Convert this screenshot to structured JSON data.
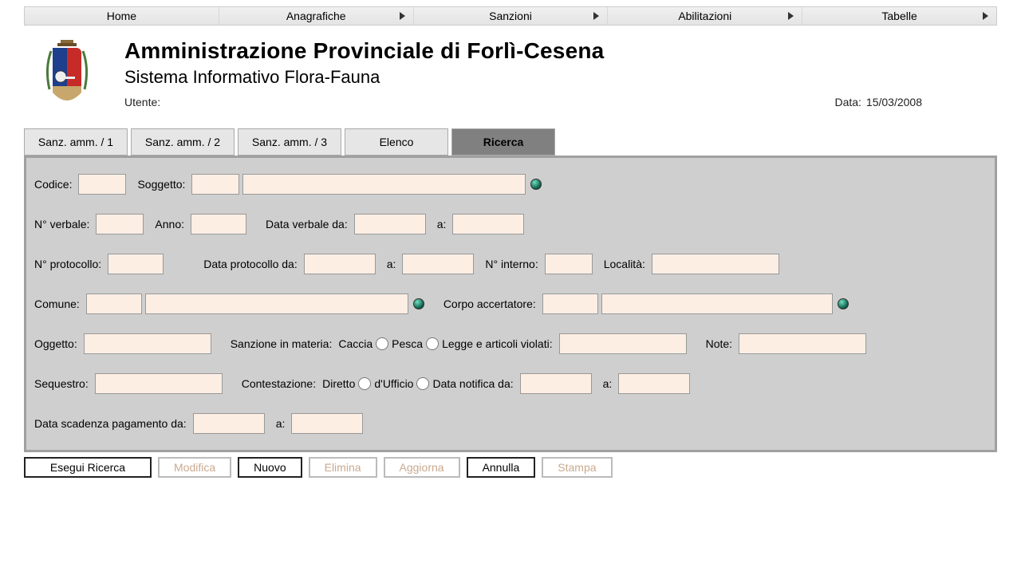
{
  "menu": {
    "home": "Home",
    "anagrafiche": "Anagrafiche",
    "sanzioni": "Sanzioni",
    "abilitazioni": "Abilitazioni",
    "tabelle": "Tabelle"
  },
  "header": {
    "title": "Amministrazione Provinciale di Forlì-Cesena",
    "subtitle": "Sistema Informativo Flora-Fauna",
    "user_label": "Utente:",
    "user_value": "",
    "date_label": "Data:",
    "date_value": "15/03/2008"
  },
  "tabs": {
    "t1": "Sanz. amm. / 1",
    "t2": "Sanz. amm. / 2",
    "t3": "Sanz. amm. / 3",
    "t4": "Elenco",
    "t5": "Ricerca"
  },
  "form": {
    "codice_label": "Codice:",
    "codice": "",
    "soggetto_label": "Soggetto:",
    "soggetto_code": "",
    "soggetto_desc": "",
    "n_verbale_label": "N° verbale:",
    "n_verbale": "",
    "anno_label": "Anno:",
    "anno": "",
    "data_verbale_da_label": "Data verbale da:",
    "data_verbale_da": "",
    "data_verbale_a_label": "a:",
    "data_verbale_a": "",
    "n_protocollo_label": "N° protocollo:",
    "n_protocollo": "",
    "data_protocollo_da_label": "Data protocollo da:",
    "data_protocollo_da": "",
    "data_protocollo_a_label": "a:",
    "data_protocollo_a": "",
    "n_interno_label": "N° interno:",
    "n_interno": "",
    "localita_label": "Località:",
    "localita": "",
    "comune_label": "Comune:",
    "comune_code": "",
    "comune_desc": "",
    "corpo_label": "Corpo accertatore:",
    "corpo_code": "",
    "corpo_desc": "",
    "oggetto_label": "Oggetto:",
    "oggetto": "",
    "sanzione_materia_label": "Sanzione in materia:",
    "caccia_label": "Caccia",
    "pesca_label": "Pesca",
    "legge_label": "Legge e articoli violati:",
    "legge": "",
    "note_label": "Note:",
    "note": "",
    "sequestro_label": "Sequestro:",
    "sequestro": "",
    "contestazione_label": "Contestazione:",
    "diretto_label": "Diretto",
    "ufficio_label": "d'Ufficio",
    "data_notifica_da_label": "Data notifica da:",
    "data_notifica_da": "",
    "data_notifica_a_label": "a:",
    "data_notifica_a": "",
    "data_scadenza_label": "Data scadenza pagamento da:",
    "data_scadenza_da": "",
    "data_scadenza_a_label": "a:",
    "data_scadenza_a": ""
  },
  "buttons": {
    "esegui": "Esegui Ricerca",
    "modifica": "Modifica",
    "nuovo": "Nuovo",
    "elimina": "Elimina",
    "aggiorna": "Aggiorna",
    "annulla": "Annulla",
    "stampa": "Stampa"
  }
}
